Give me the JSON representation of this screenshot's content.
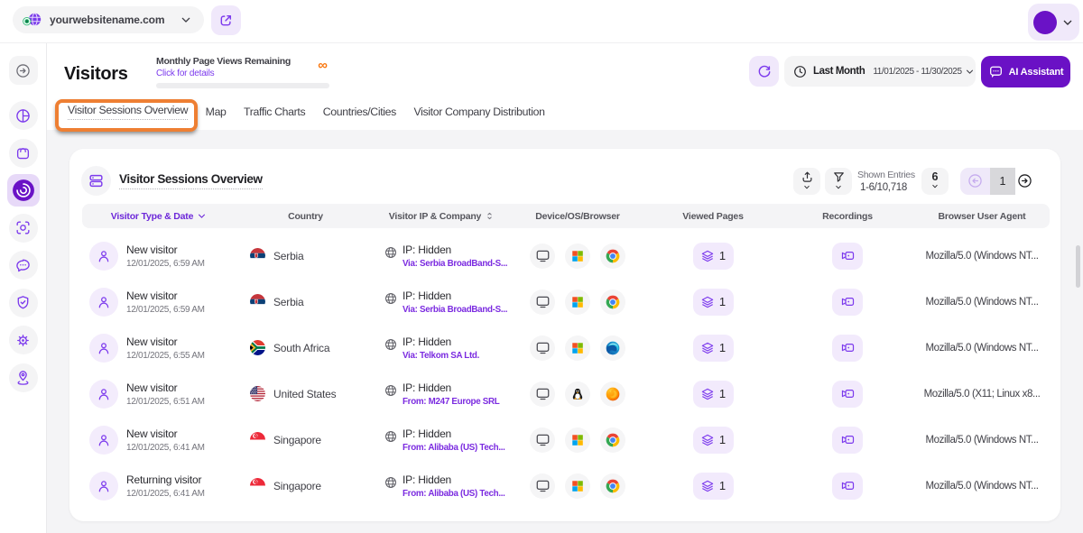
{
  "topbar": {
    "website_selector": {
      "label": "yourwebsitename.com"
    }
  },
  "sidebar": {
    "items": [
      {
        "name": "expand-sidebar"
      },
      {
        "name": "dashboard"
      },
      {
        "name": "ecommerce"
      },
      {
        "name": "visitors",
        "active": true
      },
      {
        "name": "session-recordings"
      },
      {
        "name": "feedback"
      },
      {
        "name": "privacy"
      },
      {
        "name": "settings"
      },
      {
        "name": "visitor-location"
      }
    ]
  },
  "header": {
    "title": "Visitors",
    "quota": {
      "label": "Monthly Page Views Remaining",
      "link": "Click for details",
      "value": "∞"
    },
    "date_range": {
      "preset": "Last Month",
      "range": "11/01/2025 - 11/30/2025"
    },
    "ai_button_label": "AI Assistant"
  },
  "tabs": [
    {
      "label": "Visitor Sessions Overview",
      "active": true,
      "annotated": true
    },
    {
      "label": "Map",
      "active": false
    },
    {
      "label": "Traffic Charts",
      "active": false
    },
    {
      "label": "Countries/Cities",
      "active": false
    },
    {
      "label": "Visitor Company Distribution",
      "active": false
    }
  ],
  "card": {
    "title": "Visitor Sessions Overview",
    "toolbar": {
      "shown_entries_label": "Shown Entries",
      "shown_entries_value": "1-6/10,718",
      "page_size": "6",
      "current_page": "1"
    }
  },
  "table": {
    "columns": [
      {
        "label": "Visitor Type & Date",
        "sorted": true,
        "icon": "chevron-down-icon"
      },
      {
        "label": "Country"
      },
      {
        "label": "Visitor IP & Company",
        "icon": "sort-icon"
      },
      {
        "label": "Device/OS/Browser"
      },
      {
        "label": "Viewed Pages"
      },
      {
        "label": "Recordings"
      },
      {
        "label": "Browser User Agent"
      }
    ],
    "rows": [
      {
        "visitor_type": "New visitor",
        "datetime": "12/01/2025, 6:59 AM",
        "country": {
          "name": "Serbia",
          "flag": "serbia-flag"
        },
        "ip": {
          "line1": "IP: Hidden",
          "line2": "Via: Serbia BroadBand-S..."
        },
        "device_icons": [
          "desktop-icon",
          "windows-icon",
          "chrome-icon"
        ],
        "viewed_pages": "1",
        "recordings_icon": "video-camera-icon",
        "user_agent": "Mozilla/5.0 (Windows NT..."
      },
      {
        "visitor_type": "New visitor",
        "datetime": "12/01/2025, 6:59 AM",
        "country": {
          "name": "Serbia",
          "flag": "serbia-flag"
        },
        "ip": {
          "line1": "IP: Hidden",
          "line2": "Via: Serbia BroadBand-S..."
        },
        "device_icons": [
          "desktop-icon",
          "windows-icon",
          "chrome-icon"
        ],
        "viewed_pages": "1",
        "recordings_icon": "video-camera-icon",
        "user_agent": "Mozilla/5.0 (Windows NT..."
      },
      {
        "visitor_type": "New visitor",
        "datetime": "12/01/2025, 6:55 AM",
        "country": {
          "name": "South Africa",
          "flag": "south-africa-flag"
        },
        "ip": {
          "line1": "IP: Hidden",
          "line2": "Via: Telkom SA Ltd."
        },
        "device_icons": [
          "desktop-icon",
          "windows-icon",
          "edge-icon"
        ],
        "viewed_pages": "1",
        "recordings_icon": "video-camera-icon",
        "user_agent": "Mozilla/5.0 (Windows NT..."
      },
      {
        "visitor_type": "New visitor",
        "datetime": "12/01/2025, 6:51 AM",
        "country": {
          "name": "United States",
          "flag": "united-states-flag"
        },
        "ip": {
          "line1": "IP: Hidden",
          "line2": "From: M247 Europe SRL"
        },
        "device_icons": [
          "desktop-icon",
          "linux-icon",
          "firefox-icon"
        ],
        "viewed_pages": "1",
        "recordings_icon": "video-camera-icon",
        "user_agent": "Mozilla/5.0 (X11; Linux x8..."
      },
      {
        "visitor_type": "New visitor",
        "datetime": "12/01/2025, 6:41 AM",
        "country": {
          "name": "Singapore",
          "flag": "singapore-flag"
        },
        "ip": {
          "line1": "IP: Hidden",
          "line2": "From: Alibaba (US) Tech..."
        },
        "device_icons": [
          "desktop-icon",
          "windows-icon",
          "chrome-icon"
        ],
        "viewed_pages": "1",
        "recordings_icon": "video-camera-icon",
        "user_agent": "Mozilla/5.0 (Windows NT..."
      },
      {
        "visitor_type": "Returning visitor",
        "datetime": "12/01/2025, 6:41 AM",
        "country": {
          "name": "Singapore",
          "flag": "singapore-flag"
        },
        "ip": {
          "line1": "IP: Hidden",
          "line2": "From: Alibaba (US) Tech..."
        },
        "device_icons": [
          "desktop-icon",
          "windows-icon",
          "chrome-icon"
        ],
        "viewed_pages": "1",
        "recordings_icon": "video-camera-icon",
        "user_agent": "Mozilla/5.0 (Windows NT..."
      }
    ]
  },
  "colors": {
    "brand_purple": "#6a12c6",
    "icon_purple": "#7c3aed",
    "link_purple": "#7b2be0",
    "annotation_orange": "#ee7f33",
    "infinity_orange": "#f9750b",
    "light_purple_bg": "#f2eafc",
    "gray_pill_bg": "#f4f4f5",
    "content_bg": "#f4f4f6"
  }
}
